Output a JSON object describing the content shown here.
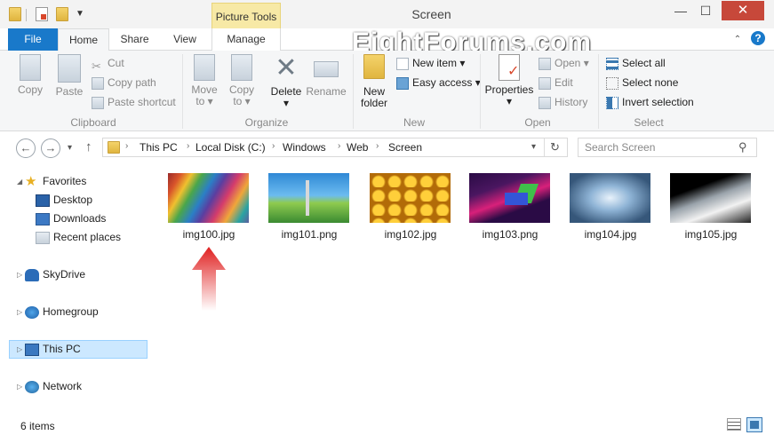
{
  "window": {
    "title": "Screen",
    "context_tab": "Picture Tools",
    "minimize": "—",
    "maximize": "☐",
    "close": "✕"
  },
  "tabs": [
    "File",
    "Home",
    "Share",
    "View",
    "Manage"
  ],
  "ribbon": {
    "clipboard": {
      "label": "Clipboard",
      "copy": "Copy",
      "paste": "Paste",
      "cut": "Cut",
      "copy_path": "Copy path",
      "paste_shortcut": "Paste shortcut"
    },
    "organize": {
      "label": "Organize",
      "move_to": "Move",
      "move_to2": "to ▾",
      "copy_to": "Copy",
      "copy_to2": "to ▾",
      "delete": "Delete",
      "delete2": "▾",
      "rename": "Rename"
    },
    "new": {
      "label": "New",
      "new_folder": "New",
      "new_folder2": "folder",
      "new_item": "New item ▾",
      "easy_access": "Easy access ▾"
    },
    "open": {
      "label": "Open",
      "properties": "Properties",
      "properties2": "▾",
      "open": "Open ▾",
      "edit": "Edit",
      "history": "History"
    },
    "select": {
      "label": "Select",
      "select_all": "Select all",
      "select_none": "Select none",
      "invert": "Invert selection"
    }
  },
  "nav": {
    "back": "←",
    "forward": "→",
    "recent": "▾",
    "up": "↑",
    "path": [
      "This PC",
      "Local Disk (C:)",
      "Windows",
      "Web",
      "Screen"
    ],
    "sep": "›",
    "dropdown": "▾",
    "refresh": "↻",
    "search_placeholder": "Search Screen"
  },
  "sidebar": {
    "favorites": "Favorites",
    "desktop": "Desktop",
    "downloads": "Downloads",
    "recent_places": "Recent places",
    "skydrive": "SkyDrive",
    "homegroup": "Homegroup",
    "this_pc": "This PC",
    "network": "Network"
  },
  "files": [
    {
      "name": "img100.jpg"
    },
    {
      "name": "img101.png"
    },
    {
      "name": "img102.jpg"
    },
    {
      "name": "img103.png"
    },
    {
      "name": "img104.jpg"
    },
    {
      "name": "img105.jpg"
    }
  ],
  "status": {
    "count": "6 items"
  },
  "watermark": "EightForums.com",
  "colors": {
    "accent": "#1979ca",
    "selection": "#cce8ff",
    "close": "#c7483a",
    "arrow": "#e02020"
  }
}
